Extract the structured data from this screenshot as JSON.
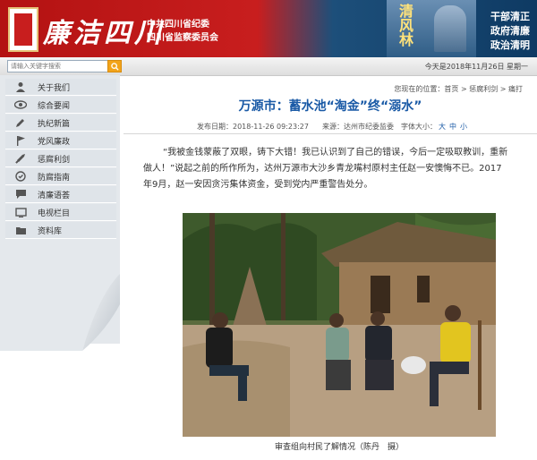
{
  "header": {
    "calligraphy": "廉洁四川",
    "org_line1": "中共四川省纪委",
    "org_line2": "四川省监察委员会",
    "banner_text": "清风林",
    "slogan": [
      "干部清正",
      "政府清廉",
      "政治清明"
    ],
    "colors": {
      "red": "#c81e1e",
      "blue": "#0e3a63",
      "gold": "#ffe27a"
    }
  },
  "topbar": {
    "search_placeholder": "请输入关键字搜索",
    "date": "今天是2018年11月26日 星期一"
  },
  "sidebar": {
    "items": [
      {
        "label": "关于我们",
        "icon": "person-icon"
      },
      {
        "label": "综合要闻",
        "icon": "eye-icon"
      },
      {
        "label": "执纪新篇",
        "icon": "pen-icon"
      },
      {
        "label": "党风廉政",
        "icon": "flag-icon"
      },
      {
        "label": "惩腐利剑",
        "icon": "sword-icon"
      },
      {
        "label": "防腐指南",
        "icon": "shield-icon"
      },
      {
        "label": "清廉语荟",
        "icon": "chat-icon"
      },
      {
        "label": "电视栏目",
        "icon": "tv-icon"
      },
      {
        "label": "资料库",
        "icon": "folder-icon"
      }
    ]
  },
  "breadcrumb": "您现在的位置：首页 > 惩腐利剑 > 痛打",
  "article": {
    "title": "万源市：蓄水池“淘金”终“溺水”",
    "published": "发布日期：2018-11-26 09:23:27",
    "source": "来源：达州市纪委监委",
    "font_size_label": "字体大小：",
    "font_sizes": [
      "大",
      "中",
      "小"
    ],
    "body": "“我被金钱蒙蔽了双眼，铸下大错！我已认识到了自己的错误，今后一定吸取教训，重新做人！”说起之前的所作所为，达州万源市大沙乡青龙嘴村原村主任赵一安懊悔不已。2017年9月，赵一安因贪污集体资金，受到党内严重警告处分。",
    "caption": "审查组向村民了解情况（陈丹　摄）"
  }
}
